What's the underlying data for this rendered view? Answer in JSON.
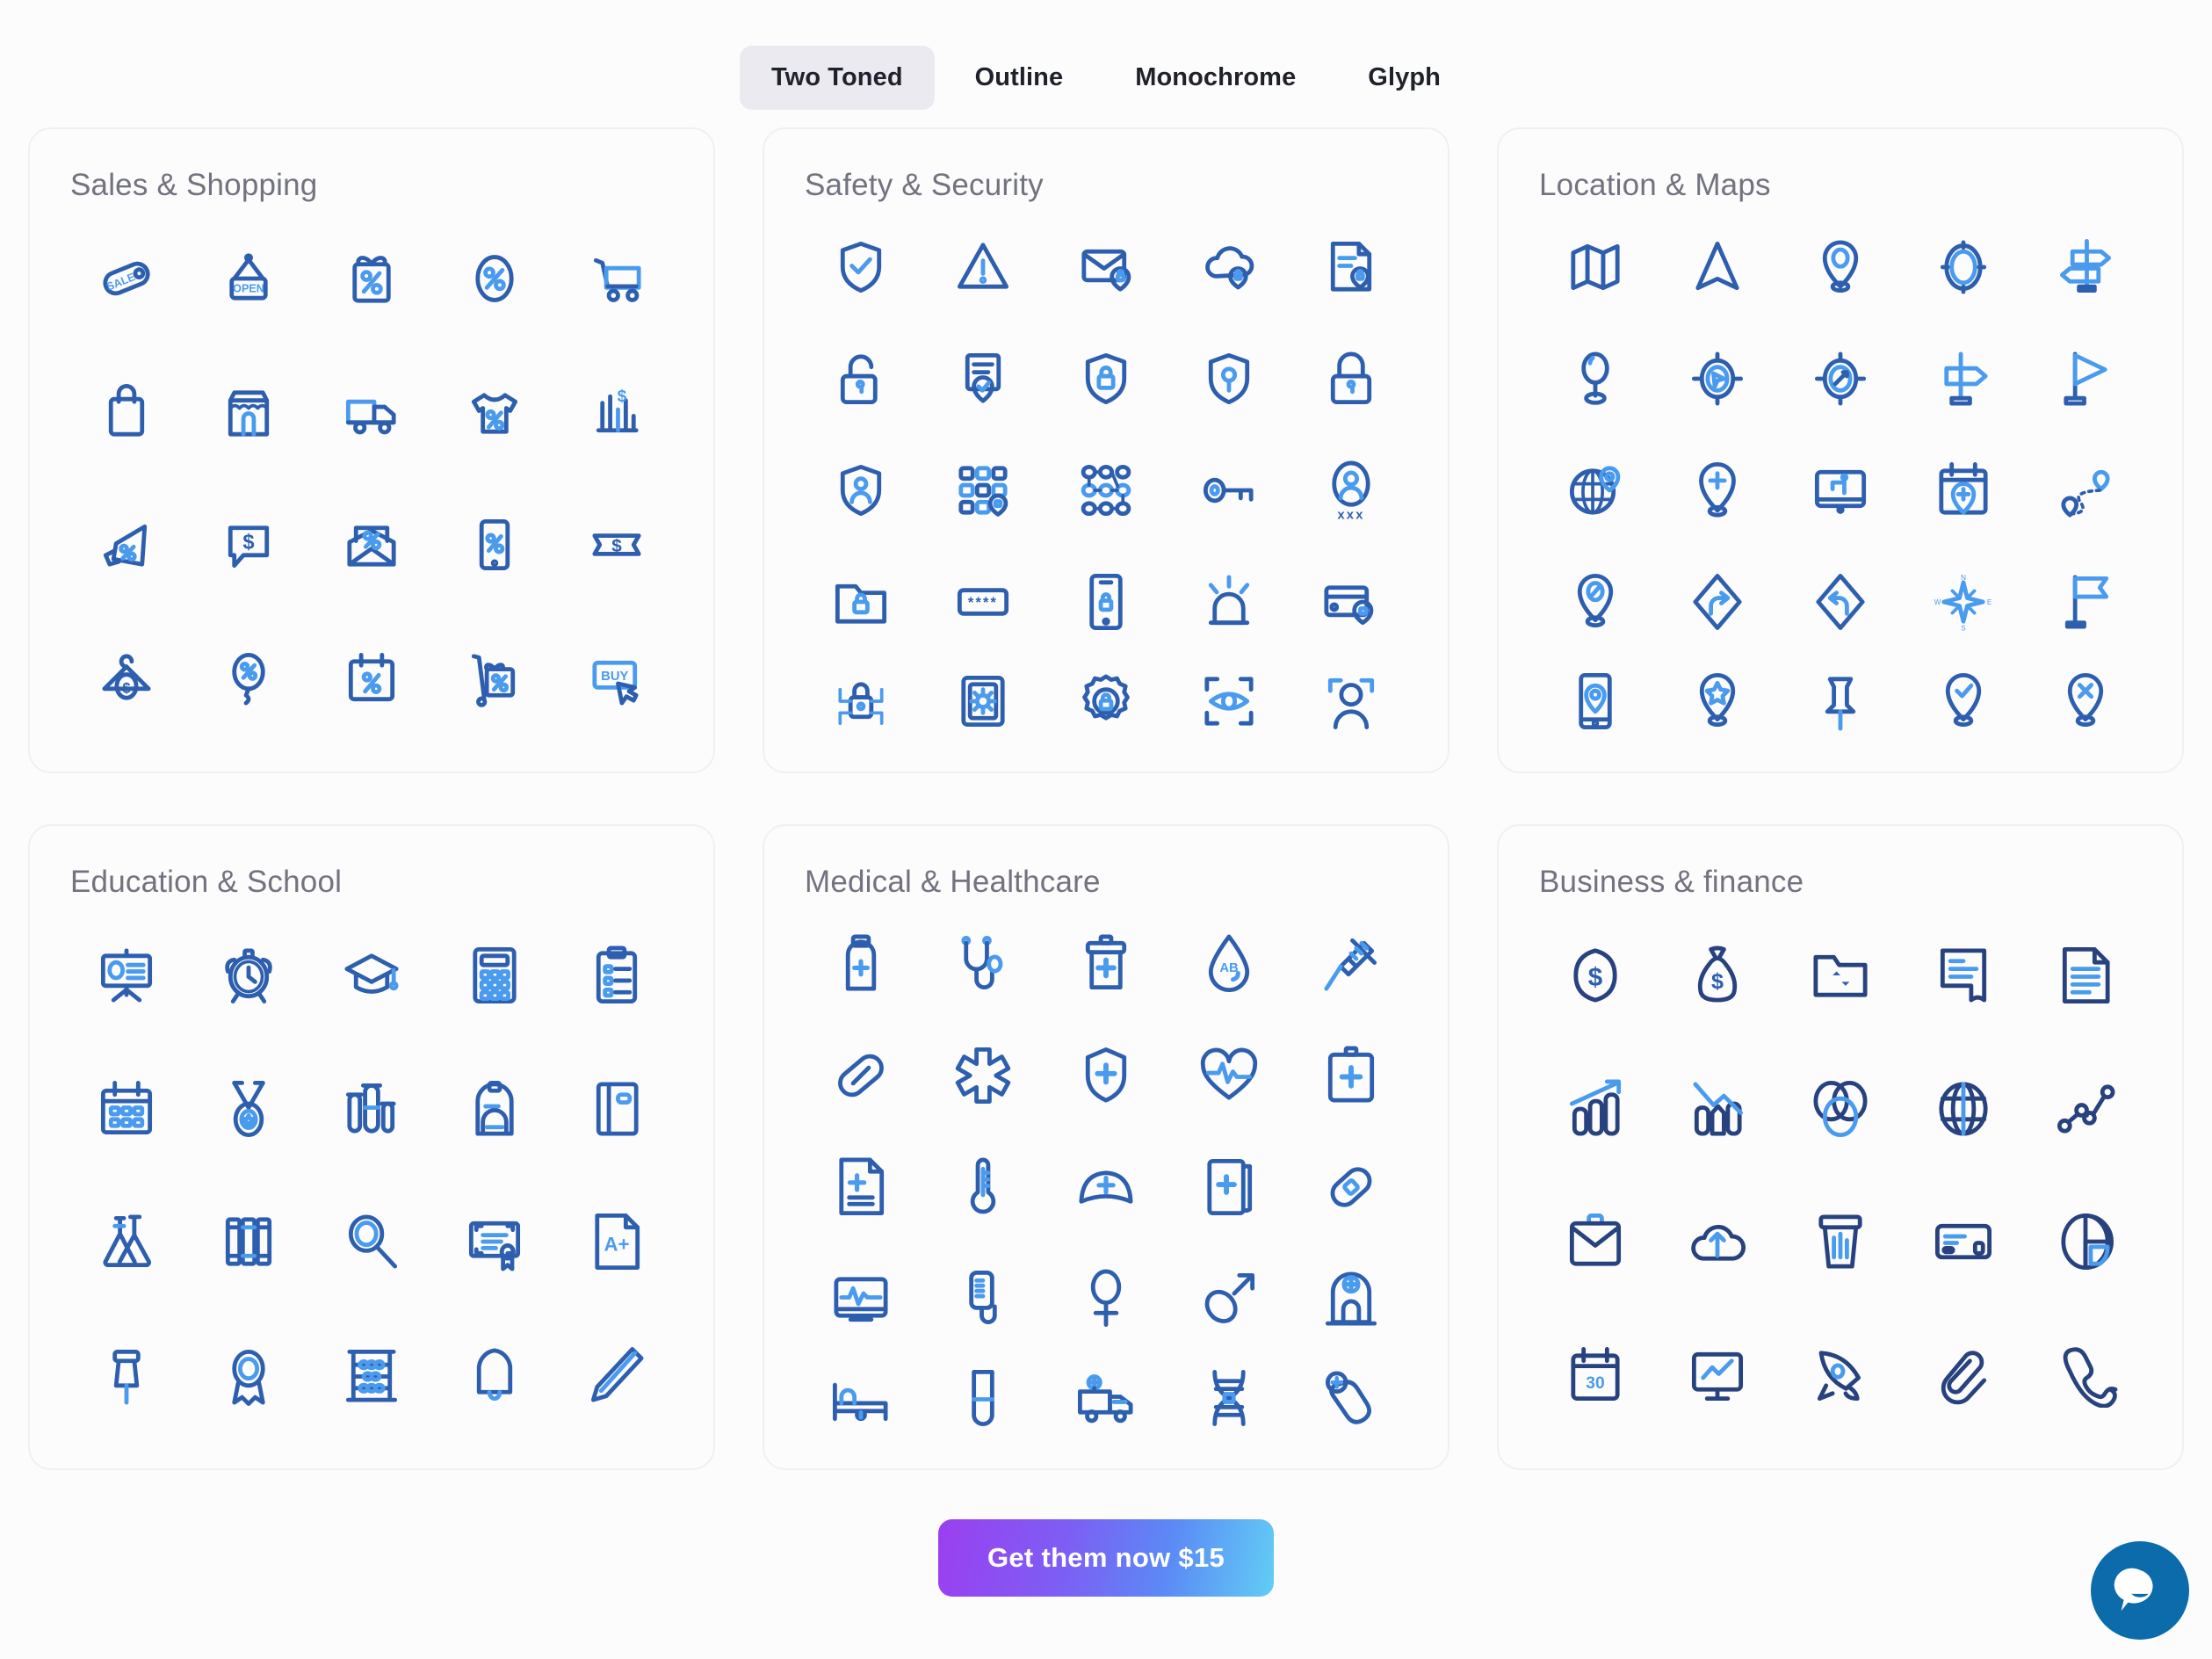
{
  "tabs": [
    {
      "label": "Two Toned",
      "active": true
    },
    {
      "label": "Outline",
      "active": false
    },
    {
      "label": "Monochrome",
      "active": false
    },
    {
      "label": "Glyph",
      "active": false
    }
  ],
  "cards": [
    {
      "title": "Sales & Shopping",
      "tone": "blue",
      "icons": [
        "sale-tag-icon",
        "open-sign-icon",
        "gift-percent-icon",
        "percent-badge-icon",
        "shopping-cart-icon",
        "shopping-bag-icon",
        "storefront-icon",
        "delivery-truck-icon",
        "tshirt-percent-icon",
        "sales-chart-dollar-icon",
        "megaphone-percent-icon",
        "dollar-speech-bubble-icon",
        "discount-mail-icon",
        "mobile-percent-icon",
        "dollar-ticket-icon",
        "hanger-dollar-icon",
        "balloon-percent-icon",
        "calendar-percent-icon",
        "gift-trolley-icon",
        "buy-button-icon"
      ]
    },
    {
      "title": "Safety & Security",
      "tone": "blue",
      "icons": [
        "shield-check-icon",
        "warning-triangle-icon",
        "secure-mail-icon",
        "cloud-lock-icon",
        "secure-document-icon",
        "unlocked-padlock-icon",
        "verified-certificate-icon",
        "shield-lock-icon",
        "shield-key-icon",
        "padlock-icon",
        "shield-user-icon",
        "secure-keypad-icon",
        "pattern-lock-icon",
        "key-icon",
        "user-password-icon",
        "secure-folder-icon",
        "password-field-icon",
        "phone-lock-icon",
        "alarm-siren-icon",
        "secure-card-icon",
        "cyber-lock-icon",
        "firewall-icon",
        "security-settings-icon",
        "eye-scan-icon",
        "face-scan-icon"
      ]
    },
    {
      "title": "Location & Maps",
      "tone": "blue",
      "icons": [
        "folded-map-icon",
        "navigation-arrow-icon",
        "map-pin-icon",
        "compass-icon",
        "direction-signs-icon",
        "location-marker-icon",
        "gps-target-icon",
        "crosshair-target-icon",
        "signpost-icon",
        "flag-pole-icon",
        "globe-pin-icon",
        "add-location-icon",
        "map-screen-icon",
        "calendar-location-icon",
        "route-path-icon",
        "blocked-location-icon",
        "turn-right-sign-icon",
        "turn-left-sign-icon",
        "compass-rose-icon",
        "flag-marker-icon",
        "mobile-map-icon",
        "favorite-location-icon",
        "push-pin-icon",
        "verified-location-icon",
        "remove-location-icon"
      ]
    },
    {
      "title": "Education & School",
      "tone": "blue",
      "icons": [
        "presentation-board-icon",
        "alarm-clock-icon",
        "graduation-cap-icon",
        "calculator-icon",
        "clipboard-list-icon",
        "school-calendar-icon",
        "medal-icon",
        "test-tubes-icon",
        "backpack-icon",
        "notebook-icon",
        "lab-flask-icon",
        "books-icon",
        "magnifier-icon",
        "diploma-icon",
        "a-plus-grade-icon",
        "thumbtack-icon",
        "award-ribbon-icon",
        "abacus-icon",
        "school-bell-icon",
        "pencil-icon"
      ]
    },
    {
      "title": "Medical & Healthcare",
      "tone": "blue",
      "icons": [
        "medicine-bottle-icon",
        "stethoscope-icon",
        "medical-bin-icon",
        "blood-drop-icon",
        "syringe-icon",
        "pill-capsule-icon",
        "star-of-life-icon",
        "medical-shield-icon",
        "heartbeat-icon",
        "first-aid-kit-icon",
        "medical-record-icon",
        "thermometer-icon",
        "nurse-cap-icon",
        "medical-book-icon",
        "bandage-icon",
        "ecg-monitor-icon",
        "iv-drip-icon",
        "female-symbol-icon",
        "male-symbol-icon",
        "hospital-icon",
        "hospital-bed-icon",
        "test-tube-icon",
        "ambulance-icon",
        "dna-icon",
        "emergency-call-icon"
      ]
    },
    {
      "title": "Business & finance",
      "tone": "navy",
      "icons": [
        "dollar-coin-icon",
        "money-bag-icon",
        "transfer-folder-icon",
        "receipt-icon",
        "document-text-icon",
        "growth-bar-chart-icon",
        "declining-chart-icon",
        "venn-diagram-icon",
        "globe-icon",
        "line-graph-icon",
        "briefcase-mail-icon",
        "cloud-upload-icon",
        "data-cup-icon",
        "credit-card-icon",
        "pie-chart-icon",
        "calendar-30-icon",
        "monitor-chart-icon",
        "rocket-icon",
        "paperclip-icon",
        "phone-handset-icon"
      ]
    }
  ],
  "cta": {
    "label": "Get them now $15"
  },
  "chat": {
    "icon": "chat-bubble-icon"
  },
  "colors": {
    "primary_dark": "#2e5fae",
    "accent_light": "#4a9bee",
    "navy": "#27427e",
    "title": "#72737f",
    "tab_active_bg": "#eceaf1",
    "card_border": "#f0f0f3",
    "page_bg": "#fcfcfd",
    "chat_bg": "#0b6bab"
  }
}
